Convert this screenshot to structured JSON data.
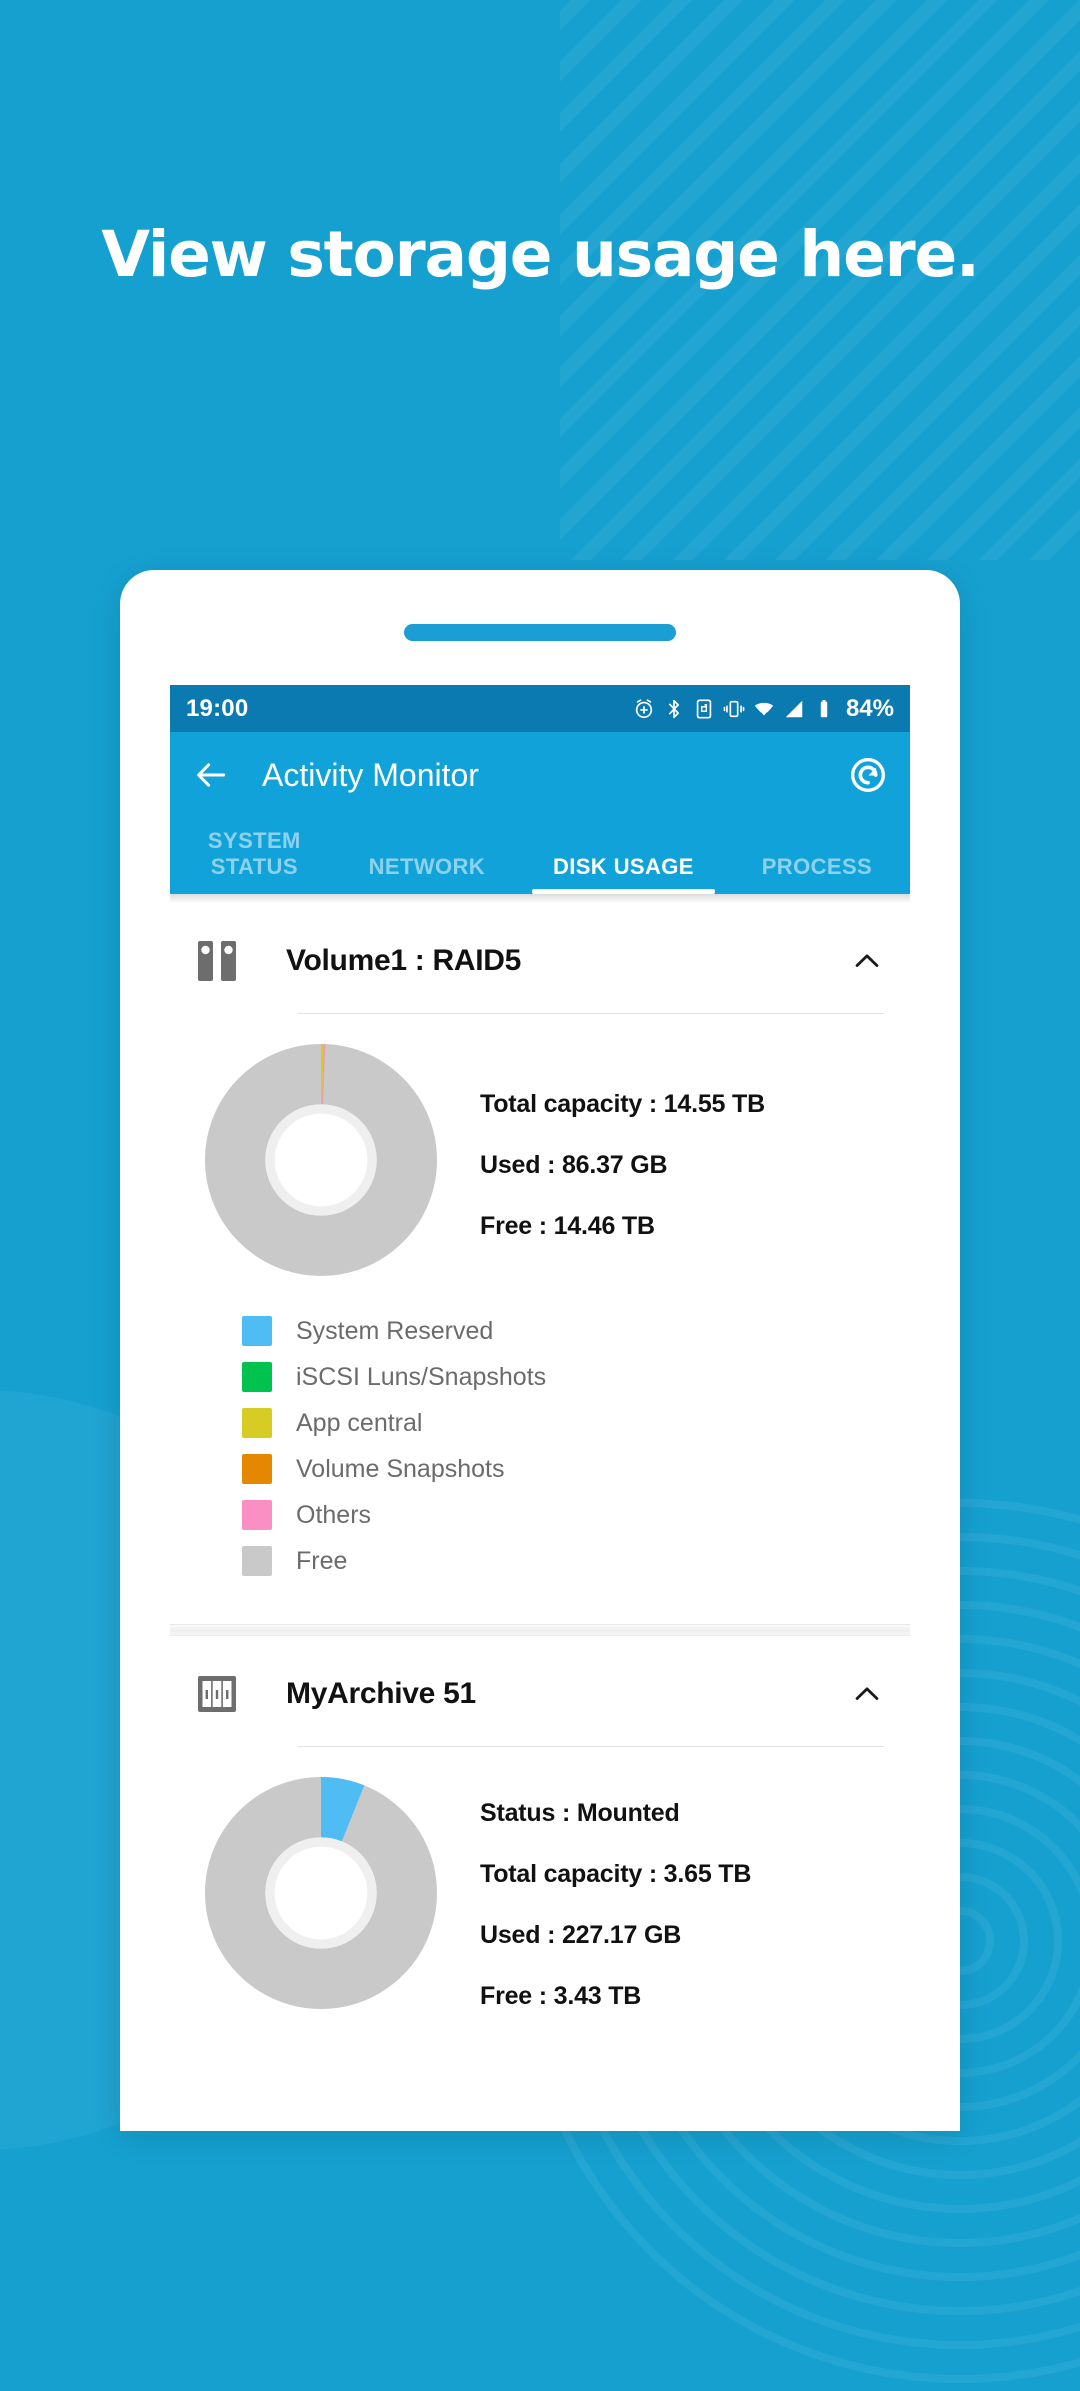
{
  "promo": {
    "headline": "View storage usage here.",
    "bg_color": "#16a0d0"
  },
  "status_bar": {
    "time": "19:00",
    "battery_percent": "84%",
    "icons": [
      "alarm-add-icon",
      "bluetooth-icon",
      "screen-rotation-icon",
      "vibrate-icon",
      "wifi-icon",
      "cell-signal-icon",
      "battery-icon"
    ]
  },
  "app_bar": {
    "back_label": "back-arrow",
    "title": "Activity Monitor",
    "action_label": "refresh"
  },
  "tabs": [
    {
      "label": "SYSTEM\nSTATUS",
      "active": false
    },
    {
      "label": "NETWORK",
      "active": false
    },
    {
      "label": "DISK USAGE",
      "active": true
    },
    {
      "label": "PROCESS",
      "active": false
    }
  ],
  "volumes": [
    {
      "icon": "disk-pair-icon",
      "name": "Volume1 : RAID5",
      "expanded": true,
      "stats": [
        "Total capacity : 14.55 TB",
        "Used : 86.37 GB",
        "Free : 14.46 TB"
      ],
      "legend": [
        {
          "label": "System Reserved",
          "color": "#4fbdf4"
        },
        {
          "label": "iSCSI Luns/Snapshots",
          "color": "#00c24e"
        },
        {
          "label": "App central",
          "color": "#d7cc23"
        },
        {
          "label": "Volume Snapshots",
          "color": "#e58800"
        },
        {
          "label": "Others",
          "color": "#fa8fc4"
        },
        {
          "label": "Free",
          "color": "#c9c9c9"
        }
      ]
    },
    {
      "icon": "archive-cabinet-icon",
      "name": "MyArchive 51",
      "expanded": true,
      "stats": [
        "Status : Mounted",
        "Total capacity : 3.65 TB",
        "Used : 227.17 GB",
        "Free : 3.43 TB"
      ],
      "legend": []
    }
  ],
  "chart_data": [
    {
      "type": "pie",
      "title": "Volume1 : RAID5 storage usage",
      "total_label": "14.55 TB",
      "categories": [
        "System Reserved",
        "iSCSI Luns/Snapshots",
        "App central",
        "Volume Snapshots",
        "Others",
        "Free"
      ],
      "values": [
        0.0,
        0.0,
        0.35,
        0.0,
        0.23,
        99.42
      ],
      "unit": "percent",
      "colors": [
        "#4fbdf4",
        "#00c24e",
        "#d7cc23",
        "#e58800",
        "#fa8fc4",
        "#c9c9c9"
      ],
      "legend_position": "below",
      "donut": true
    },
    {
      "type": "pie",
      "title": "MyArchive 51 storage usage",
      "total_label": "3.65 TB",
      "categories": [
        "Used",
        "Free"
      ],
      "values": [
        6.08,
        93.92
      ],
      "unit": "percent",
      "colors": [
        "#4fbdf4",
        "#c9c9c9"
      ],
      "legend_position": "none",
      "donut": true
    }
  ]
}
